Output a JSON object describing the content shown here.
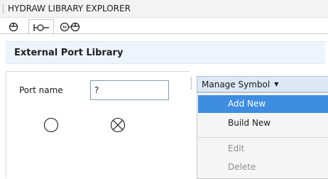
{
  "window": {
    "title": "HYDRAW LIBRARY EXPLORER"
  },
  "tabs": [
    {
      "icon": "port-symbol-icon",
      "active": false
    },
    {
      "icon": "external-port-line-icon",
      "active": true
    },
    {
      "icon": "motor-pump-icon",
      "active": false
    }
  ],
  "section": {
    "title": "External Port Library"
  },
  "form": {
    "port_name_label": "Port name",
    "port_name_value": "?"
  },
  "symbols": [
    {
      "icon": "open-port-circle-icon"
    },
    {
      "icon": "blocked-port-circle-icon"
    }
  ],
  "manage": {
    "label": "Manage Symbol",
    "caret_icon": "caret-down-icon"
  },
  "menu": {
    "items": [
      {
        "label": "Add New",
        "state": "highlighted"
      },
      {
        "label": "Build New",
        "state": "enabled"
      },
      {
        "label": "Edit",
        "state": "disabled"
      },
      {
        "label": "Delete",
        "state": "disabled"
      }
    ]
  },
  "colors": {
    "highlight": "#3e8de0",
    "header_bg": "#eef4fb",
    "button_bg": "#dde8f4",
    "disabled_text": "#8d8d8d"
  }
}
